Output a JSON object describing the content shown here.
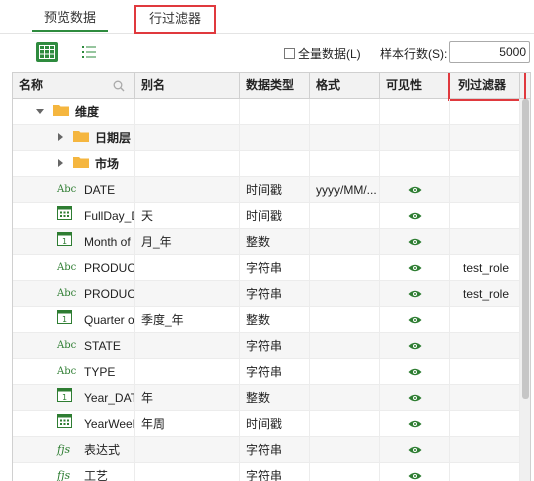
{
  "tabs": [
    {
      "label": "预览数据"
    },
    {
      "label": "行过滤器"
    }
  ],
  "toolbar": {
    "all_data_label": "全量数据(L)",
    "sample_rows_label": "样本行数(S):",
    "sample_rows_value": "5000"
  },
  "columns": [
    "名称",
    "别名",
    "数据类型",
    "格式",
    "可见性",
    "列过滤器"
  ],
  "rows": [
    {
      "name": "维度",
      "alias": "",
      "type": "",
      "format": "",
      "visible": false,
      "filter": "",
      "icon": "folder-icon",
      "level": 0
    },
    {
      "name": "日期层",
      "alias": "",
      "type": "",
      "format": "",
      "visible": false,
      "filter": "",
      "icon": "folder-icon",
      "level": 1
    },
    {
      "name": "市场",
      "alias": "",
      "type": "",
      "format": "",
      "visible": false,
      "filter": "",
      "icon": "folder-icon",
      "level": 1
    },
    {
      "name": "DATE",
      "alias": "",
      "type": "时间戳",
      "format": "yyyy/MM/...",
      "visible": true,
      "filter": "",
      "icon": "abc-icon",
      "level": 2
    },
    {
      "name": "FullDay_D",
      "alias": "天",
      "type": "时间戳",
      "format": "",
      "visible": true,
      "filter": "",
      "icon": "calendar-grid-icon",
      "level": 2
    },
    {
      "name": "Month of",
      "alias": "月_年",
      "type": "整数",
      "format": "",
      "visible": true,
      "filter": "",
      "icon": "calendar-icon",
      "level": 2
    },
    {
      "name": "PRODUCT",
      "alias": "",
      "type": "字符串",
      "format": "",
      "visible": true,
      "filter": "test_role",
      "icon": "abc-icon",
      "level": 2
    },
    {
      "name": "PRODUCT",
      "alias": "",
      "type": "字符串",
      "format": "",
      "visible": true,
      "filter": "test_role",
      "icon": "abc-icon",
      "level": 2
    },
    {
      "name": "Quarter of",
      "alias": "季度_年",
      "type": "整数",
      "format": "",
      "visible": true,
      "filter": "",
      "icon": "calendar-icon",
      "level": 2
    },
    {
      "name": "STATE",
      "alias": "",
      "type": "字符串",
      "format": "",
      "visible": true,
      "filter": "",
      "icon": "abc-icon",
      "level": 2
    },
    {
      "name": "TYPE",
      "alias": "",
      "type": "字符串",
      "format": "",
      "visible": true,
      "filter": "",
      "icon": "abc-icon",
      "level": 2
    },
    {
      "name": "Year_DATE",
      "alias": "年",
      "type": "整数",
      "format": "",
      "visible": true,
      "filter": "",
      "icon": "calendar-icon",
      "level": 2
    },
    {
      "name": "YearWeek_",
      "alias": "年周",
      "type": "时间戳",
      "format": "",
      "visible": true,
      "filter": "",
      "icon": "calendar-grid-icon",
      "level": 2
    },
    {
      "name": "表达式",
      "alias": "",
      "type": "字符串",
      "format": "",
      "visible": true,
      "filter": "",
      "icon": "fjs-icon",
      "level": 2
    },
    {
      "name": "工艺",
      "alias": "",
      "type": "字符串",
      "format": "",
      "visible": true,
      "filter": "",
      "icon": "fjs-icon",
      "level": 2
    }
  ],
  "colors": {
    "accent": "#2e8b3e",
    "highlight": "#e0393e",
    "folder": "#f4b63f"
  }
}
